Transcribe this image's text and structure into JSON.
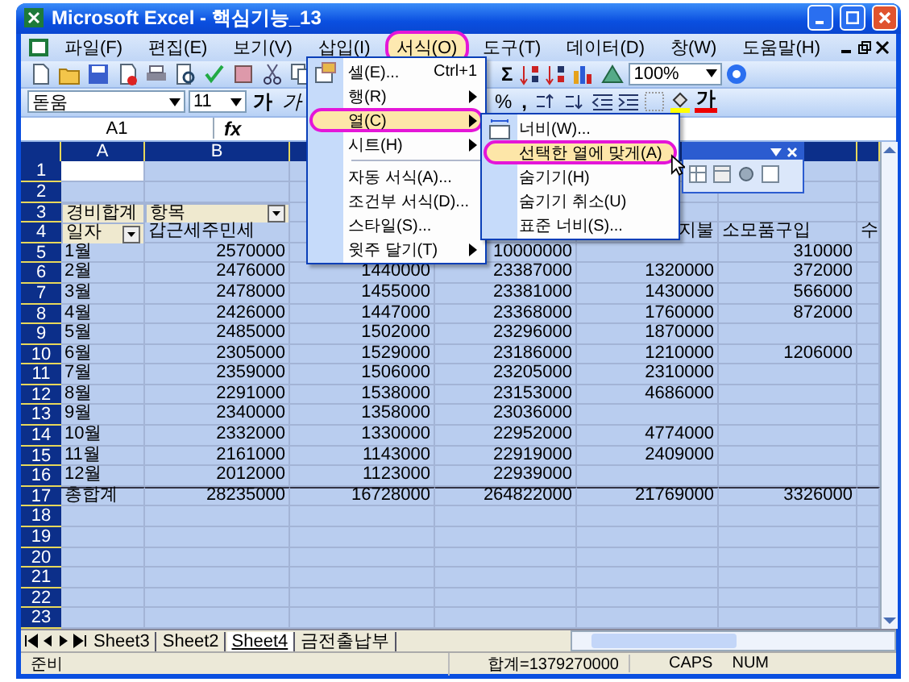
{
  "window": {
    "title": "Microsoft Excel - 핵심기능_13"
  },
  "menu_bar": [
    {
      "label": "파일(F)",
      "open": false,
      "circled": false
    },
    {
      "label": "편집(E)",
      "open": false,
      "circled": false
    },
    {
      "label": "보기(V)",
      "open": false,
      "circled": false
    },
    {
      "label": "삽입(I)",
      "open": false,
      "circled": false
    },
    {
      "label": "서식(O)",
      "open": true,
      "circled": true
    },
    {
      "label": "도구(T)",
      "open": false,
      "circled": false
    },
    {
      "label": "데이터(D)",
      "open": false,
      "circled": false
    },
    {
      "label": "창(W)",
      "open": false,
      "circled": false
    },
    {
      "label": "도움말(H)",
      "open": false,
      "circled": false
    }
  ],
  "standard_toolbar": {
    "autosum": "Σ",
    "zoom": "100%"
  },
  "format_toolbar": {
    "font": "돋움",
    "size": "11",
    "bold": "가",
    "italic": "가",
    "percent": "%",
    "comma": ",",
    "font_color": "가"
  },
  "formula_bar": {
    "name_box": "A1",
    "function": "fx"
  },
  "format_menu": [
    {
      "kind": "command",
      "label": "셀(E)...",
      "shortcut": "Ctrl+1",
      "selected": false,
      "circled": false
    },
    {
      "kind": "submenu",
      "label": "행(R)",
      "selected": false,
      "circled": false
    },
    {
      "kind": "submenu",
      "label": "열(C)",
      "selected": true,
      "circled": true
    },
    {
      "kind": "submenu",
      "label": "시트(H)",
      "selected": false,
      "circled": false
    },
    {
      "kind": "separator"
    },
    {
      "kind": "command",
      "label": "자동 서식(A)...",
      "selected": false,
      "circled": false
    },
    {
      "kind": "command",
      "label": "조건부 서식(D)...",
      "selected": false,
      "circled": false
    },
    {
      "kind": "command",
      "label": "스타일(S)...",
      "selected": false,
      "circled": false
    },
    {
      "kind": "submenu",
      "label": "윗주 달기(T)",
      "selected": false,
      "circled": false
    }
  ],
  "column_submenu": [
    {
      "label": "너비(W)...",
      "selected": false,
      "circled": false
    },
    {
      "label": "선택한 열에 맞게(A)",
      "selected": true,
      "circled": true
    },
    {
      "label": "숨기기(H)",
      "selected": false,
      "circled": false
    },
    {
      "label": "숨기기 취소(U)",
      "selected": false,
      "circled": false
    },
    {
      "label": "표준 너비(S)...",
      "selected": false,
      "circled": false
    }
  ],
  "grid": {
    "all_selected": true,
    "columns": [
      "A",
      "B"
    ],
    "rows": [
      {
        "header": "1",
        "kind": "data",
        "cells": [
          {
            "active": true
          }
        ]
      },
      {
        "header": "2",
        "kind": "data",
        "cells": []
      },
      {
        "header": "3",
        "kind": "data",
        "cells": [
          {
            "text": "경비합계",
            "kind": "field",
            "filter": false
          },
          {
            "text": "항목",
            "kind": "field",
            "filter": true
          }
        ]
      },
      {
        "header": "4",
        "kind": "header",
        "cells": [
          {
            "text": "일자",
            "kind": "field",
            "filter": true
          },
          "갑근세주민세",
          null,
          null,
          {
            "text": "지불",
            "cut_left": true
          },
          "소모품구입",
          "수"
        ]
      },
      {
        "header": "5",
        "kind": "data",
        "cells": [
          "1월",
          "2570000",
          null,
          "10000000",
          null,
          "310000"
        ]
      },
      {
        "header": "6",
        "kind": "data",
        "cells": [
          "2월",
          "2476000",
          "1440000",
          "23387000",
          "1320000",
          "372000"
        ]
      },
      {
        "header": "7",
        "kind": "data",
        "cells": [
          "3월",
          "2478000",
          "1455000",
          "23381000",
          "1430000",
          "566000"
        ]
      },
      {
        "header": "8",
        "kind": "data",
        "cells": [
          "4월",
          "2426000",
          "1447000",
          "23368000",
          "1760000",
          "872000"
        ]
      },
      {
        "header": "9",
        "kind": "data",
        "cells": [
          "5월",
          "2485000",
          "1502000",
          "23296000",
          "1870000"
        ]
      },
      {
        "header": "10",
        "kind": "data",
        "cells": [
          "6월",
          "2305000",
          "1529000",
          "23186000",
          "1210000",
          "1206000"
        ]
      },
      {
        "header": "11",
        "kind": "data",
        "cells": [
          "7월",
          "2359000",
          "1506000",
          "23205000",
          "2310000"
        ]
      },
      {
        "header": "12",
        "kind": "data",
        "cells": [
          "8월",
          "2291000",
          "1538000",
          "23153000",
          "4686000"
        ]
      },
      {
        "header": "13",
        "kind": "data",
        "cells": [
          "9월",
          "2340000",
          "1358000",
          "23036000"
        ]
      },
      {
        "header": "14",
        "kind": "data",
        "cells": [
          "10월",
          "2332000",
          "1330000",
          "22952000",
          "4774000"
        ]
      },
      {
        "header": "15",
        "kind": "data",
        "cells": [
          "11월",
          "2161000",
          "1143000",
          "22919000",
          "2409000"
        ]
      },
      {
        "header": "16",
        "kind": "data",
        "cells": [
          "12월",
          "2012000",
          "1123000",
          "22939000"
        ]
      },
      {
        "header": "17",
        "kind": "total",
        "cells": [
          "총합계",
          "28235000",
          "16728000",
          "264822000",
          "21769000",
          "3326000"
        ]
      },
      {
        "header": "18",
        "kind": "data",
        "cells": []
      },
      {
        "header": "19",
        "kind": "data",
        "cells": []
      },
      {
        "header": "20",
        "kind": "data",
        "cells": []
      },
      {
        "header": "21",
        "kind": "data",
        "cells": []
      },
      {
        "header": "22",
        "kind": "data",
        "cells": []
      },
      {
        "header": "23",
        "kind": "data",
        "cells": []
      }
    ]
  },
  "sheet_tabs": [
    {
      "label": "Sheet3",
      "selected": false
    },
    {
      "label": "Sheet2",
      "selected": false
    },
    {
      "label": "Sheet4",
      "selected": true
    },
    {
      "label": "금전출납부",
      "selected": false
    }
  ],
  "status_bar": {
    "mode": "준비",
    "sum": "합계=1379270000",
    "caps": "CAPS",
    "num": "NUM"
  }
}
